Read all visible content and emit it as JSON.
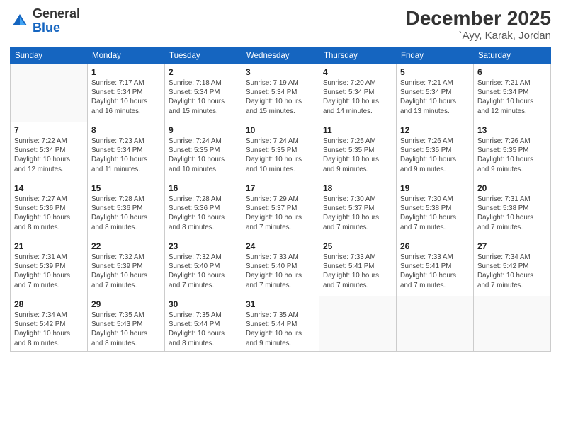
{
  "logo": {
    "general": "General",
    "blue": "Blue"
  },
  "header": {
    "month": "December 2025",
    "location": "`Ayy, Karak, Jordan"
  },
  "weekdays": [
    "Sunday",
    "Monday",
    "Tuesday",
    "Wednesday",
    "Thursday",
    "Friday",
    "Saturday"
  ],
  "weeks": [
    [
      {
        "day": "",
        "info": ""
      },
      {
        "day": "1",
        "info": "Sunrise: 7:17 AM\nSunset: 5:34 PM\nDaylight: 10 hours\nand 16 minutes."
      },
      {
        "day": "2",
        "info": "Sunrise: 7:18 AM\nSunset: 5:34 PM\nDaylight: 10 hours\nand 15 minutes."
      },
      {
        "day": "3",
        "info": "Sunrise: 7:19 AM\nSunset: 5:34 PM\nDaylight: 10 hours\nand 15 minutes."
      },
      {
        "day": "4",
        "info": "Sunrise: 7:20 AM\nSunset: 5:34 PM\nDaylight: 10 hours\nand 14 minutes."
      },
      {
        "day": "5",
        "info": "Sunrise: 7:21 AM\nSunset: 5:34 PM\nDaylight: 10 hours\nand 13 minutes."
      },
      {
        "day": "6",
        "info": "Sunrise: 7:21 AM\nSunset: 5:34 PM\nDaylight: 10 hours\nand 12 minutes."
      }
    ],
    [
      {
        "day": "7",
        "info": "Sunrise: 7:22 AM\nSunset: 5:34 PM\nDaylight: 10 hours\nand 12 minutes."
      },
      {
        "day": "8",
        "info": "Sunrise: 7:23 AM\nSunset: 5:34 PM\nDaylight: 10 hours\nand 11 minutes."
      },
      {
        "day": "9",
        "info": "Sunrise: 7:24 AM\nSunset: 5:35 PM\nDaylight: 10 hours\nand 10 minutes."
      },
      {
        "day": "10",
        "info": "Sunrise: 7:24 AM\nSunset: 5:35 PM\nDaylight: 10 hours\nand 10 minutes."
      },
      {
        "day": "11",
        "info": "Sunrise: 7:25 AM\nSunset: 5:35 PM\nDaylight: 10 hours\nand 9 minutes."
      },
      {
        "day": "12",
        "info": "Sunrise: 7:26 AM\nSunset: 5:35 PM\nDaylight: 10 hours\nand 9 minutes."
      },
      {
        "day": "13",
        "info": "Sunrise: 7:26 AM\nSunset: 5:35 PM\nDaylight: 10 hours\nand 9 minutes."
      }
    ],
    [
      {
        "day": "14",
        "info": "Sunrise: 7:27 AM\nSunset: 5:36 PM\nDaylight: 10 hours\nand 8 minutes."
      },
      {
        "day": "15",
        "info": "Sunrise: 7:28 AM\nSunset: 5:36 PM\nDaylight: 10 hours\nand 8 minutes."
      },
      {
        "day": "16",
        "info": "Sunrise: 7:28 AM\nSunset: 5:36 PM\nDaylight: 10 hours\nand 8 minutes."
      },
      {
        "day": "17",
        "info": "Sunrise: 7:29 AM\nSunset: 5:37 PM\nDaylight: 10 hours\nand 7 minutes."
      },
      {
        "day": "18",
        "info": "Sunrise: 7:30 AM\nSunset: 5:37 PM\nDaylight: 10 hours\nand 7 minutes."
      },
      {
        "day": "19",
        "info": "Sunrise: 7:30 AM\nSunset: 5:38 PM\nDaylight: 10 hours\nand 7 minutes."
      },
      {
        "day": "20",
        "info": "Sunrise: 7:31 AM\nSunset: 5:38 PM\nDaylight: 10 hours\nand 7 minutes."
      }
    ],
    [
      {
        "day": "21",
        "info": "Sunrise: 7:31 AM\nSunset: 5:39 PM\nDaylight: 10 hours\nand 7 minutes."
      },
      {
        "day": "22",
        "info": "Sunrise: 7:32 AM\nSunset: 5:39 PM\nDaylight: 10 hours\nand 7 minutes."
      },
      {
        "day": "23",
        "info": "Sunrise: 7:32 AM\nSunset: 5:40 PM\nDaylight: 10 hours\nand 7 minutes."
      },
      {
        "day": "24",
        "info": "Sunrise: 7:33 AM\nSunset: 5:40 PM\nDaylight: 10 hours\nand 7 minutes."
      },
      {
        "day": "25",
        "info": "Sunrise: 7:33 AM\nSunset: 5:41 PM\nDaylight: 10 hours\nand 7 minutes."
      },
      {
        "day": "26",
        "info": "Sunrise: 7:33 AM\nSunset: 5:41 PM\nDaylight: 10 hours\nand 7 minutes."
      },
      {
        "day": "27",
        "info": "Sunrise: 7:34 AM\nSunset: 5:42 PM\nDaylight: 10 hours\nand 7 minutes."
      }
    ],
    [
      {
        "day": "28",
        "info": "Sunrise: 7:34 AM\nSunset: 5:42 PM\nDaylight: 10 hours\nand 8 minutes."
      },
      {
        "day": "29",
        "info": "Sunrise: 7:35 AM\nSunset: 5:43 PM\nDaylight: 10 hours\nand 8 minutes."
      },
      {
        "day": "30",
        "info": "Sunrise: 7:35 AM\nSunset: 5:44 PM\nDaylight: 10 hours\nand 8 minutes."
      },
      {
        "day": "31",
        "info": "Sunrise: 7:35 AM\nSunset: 5:44 PM\nDaylight: 10 hours\nand 9 minutes."
      },
      {
        "day": "",
        "info": ""
      },
      {
        "day": "",
        "info": ""
      },
      {
        "day": "",
        "info": ""
      }
    ]
  ]
}
